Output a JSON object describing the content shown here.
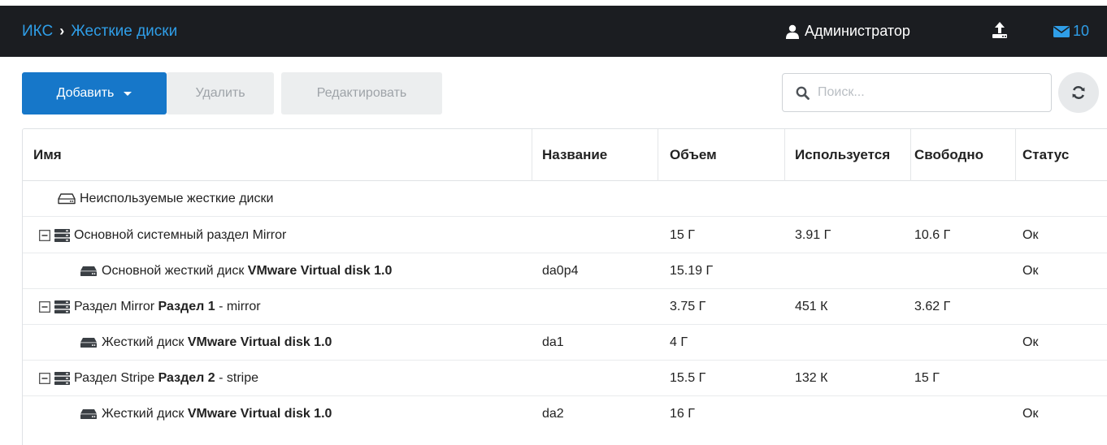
{
  "header": {
    "crumb_root": "ИКС",
    "crumb_current": "Жесткие диски",
    "user_name": "Администратор",
    "mail_count": "10"
  },
  "toolbar": {
    "add_label": "Добавить",
    "delete_label": "Удалить",
    "edit_label": "Редактировать"
  },
  "search": {
    "placeholder": "Поиск..."
  },
  "table": {
    "columns": {
      "name": "Имя",
      "title": "Название",
      "size": "Объем",
      "used": "Используется",
      "free": "Свободно",
      "status": "Статус"
    },
    "rows": [
      {
        "name_plain": "Неиспользуемые жесткие диски",
        "name_bold": "",
        "name_suffix": "",
        "title": "",
        "size": "",
        "used": "",
        "free": "",
        "status": ""
      },
      {
        "name_plain": "Основной системный раздел Mirror",
        "name_bold": "",
        "name_suffix": "",
        "title": "",
        "size": "15 Г",
        "used": "3.91 Г",
        "free": "10.6 Г",
        "status": "Ок"
      },
      {
        "name_plain": "Основной жесткий диск ",
        "name_bold": "VMware Virtual disk 1.0",
        "name_suffix": "",
        "title": "da0p4",
        "size": "15.19 Г",
        "used": "",
        "free": "",
        "status": "Ок"
      },
      {
        "name_plain": "Раздел Mirror ",
        "name_bold": "Раздел 1",
        "name_suffix": " - mirror",
        "title": "",
        "size": "3.75 Г",
        "used": "451 К",
        "free": "3.62 Г",
        "status": ""
      },
      {
        "name_plain": "Жесткий диск ",
        "name_bold": "VMware Virtual disk 1.0",
        "name_suffix": "",
        "title": "da1",
        "size": "4 Г",
        "used": "",
        "free": "",
        "status": "Ок"
      },
      {
        "name_plain": "Раздел Stripe ",
        "name_bold": "Раздел 2",
        "name_suffix": " - stripe",
        "title": "",
        "size": "15.5 Г",
        "used": "132 К",
        "free": "15 Г",
        "status": ""
      },
      {
        "name_plain": "Жесткий диск ",
        "name_bold": "VMware Virtual disk 1.0",
        "name_suffix": "",
        "title": "da2",
        "size": "16 Г",
        "used": "",
        "free": "",
        "status": "Ок"
      }
    ]
  },
  "colors": {
    "topbar": "#1b1d21",
    "link": "#2f9ee8",
    "primary": "#1677c9"
  }
}
